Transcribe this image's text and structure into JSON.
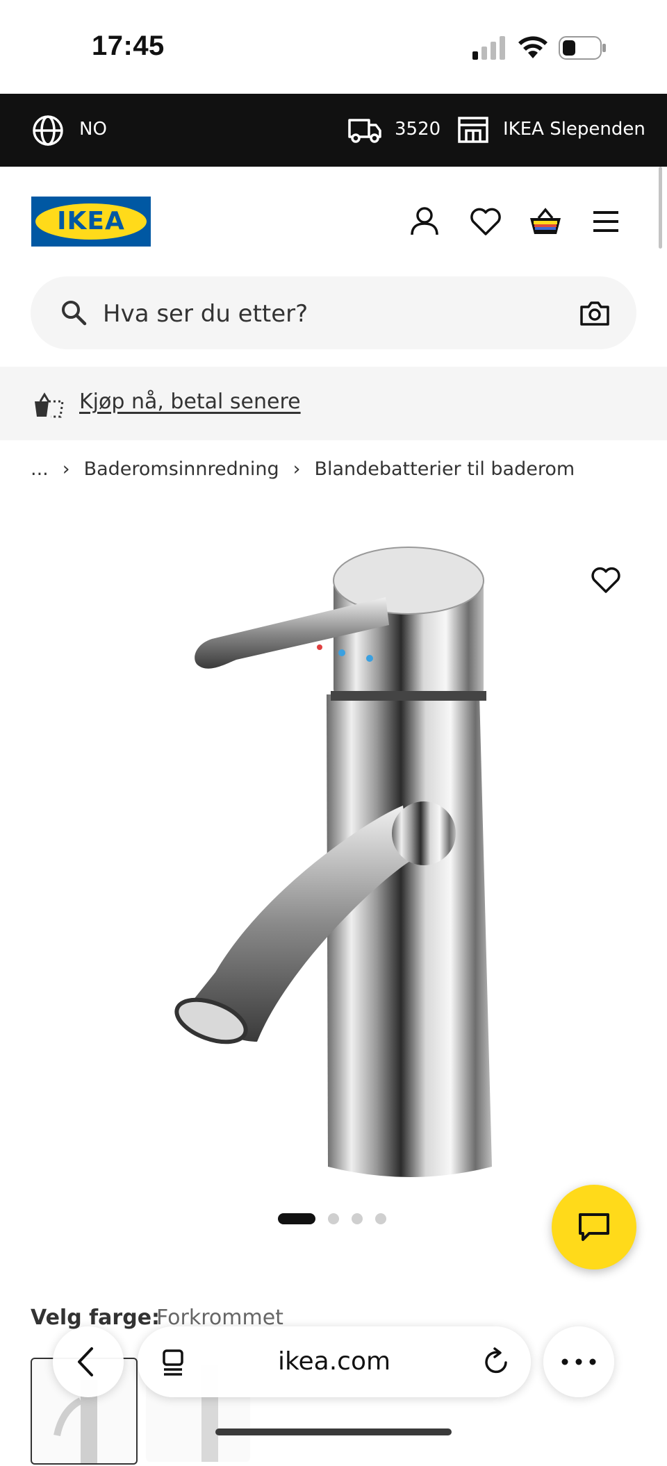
{
  "status_bar": {
    "time": "17:45",
    "battery_level": 0.3
  },
  "topbar": {
    "language": "NO",
    "postal_code": "3520",
    "store": "IKEA Slependen"
  },
  "header": {
    "logo_text": "IKEA"
  },
  "search": {
    "placeholder": "Hva ser du etter?"
  },
  "bnpl": {
    "link": "Kjøp nå, betal senere"
  },
  "breadcrumb": {
    "ellipsis": "...",
    "items": [
      "Baderomsinnredning",
      "Blandebatterier til baderom"
    ]
  },
  "carousel": {
    "total": 4,
    "active": 1
  },
  "color": {
    "label": "Velg farge:",
    "value": "Forkrommet"
  },
  "browser": {
    "url": "ikea.com"
  },
  "colors": {
    "brand_blue": "#0058a3",
    "brand_yellow": "#ffda1a",
    "topbar": "#111111"
  }
}
